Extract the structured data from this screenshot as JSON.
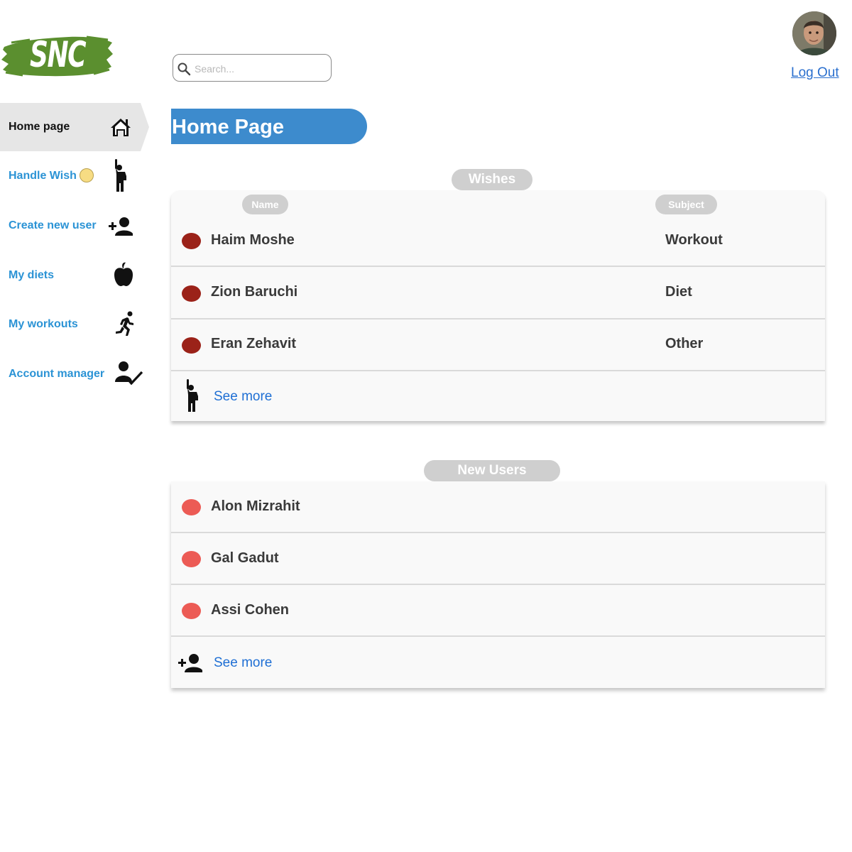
{
  "brand": {
    "logo_text": "SNC",
    "logo_color": "#5b8f2f"
  },
  "search": {
    "placeholder": "Search..."
  },
  "user": {
    "logout_label": "Log Out"
  },
  "sidebar": {
    "items": [
      {
        "label": "Home page",
        "icon": "home-icon",
        "active": true
      },
      {
        "label": "Handle Wish",
        "icon": "raised-hand-person-icon",
        "badge": "notification-dot"
      },
      {
        "label": "Create new user",
        "icon": "add-user-icon"
      },
      {
        "label": "My diets",
        "icon": "apple-icon"
      },
      {
        "label": "My workouts",
        "icon": "running-person-icon"
      },
      {
        "label": "Account manager",
        "icon": "user-check-icon"
      }
    ]
  },
  "page": {
    "title": "Home Page",
    "title_color": "#3d8bcd"
  },
  "wishes": {
    "header": "Wishes",
    "columns": {
      "name": "Name",
      "subject": "Subject"
    },
    "rows": [
      {
        "name": "Haim Moshe",
        "subject": "Workout"
      },
      {
        "name": "Zion Baruchi",
        "subject": "Diet"
      },
      {
        "name": "Eran Zehavit",
        "subject": "Other"
      }
    ],
    "dot_color": "#9b2219",
    "see_more": "See more"
  },
  "new_users": {
    "header": "New Users",
    "rows": [
      {
        "name": "Alon Mizrahit"
      },
      {
        "name": "Gal Gadut"
      },
      {
        "name": "Assi Cohen"
      }
    ],
    "dot_color": "#ec5b55",
    "see_more": "See more"
  }
}
